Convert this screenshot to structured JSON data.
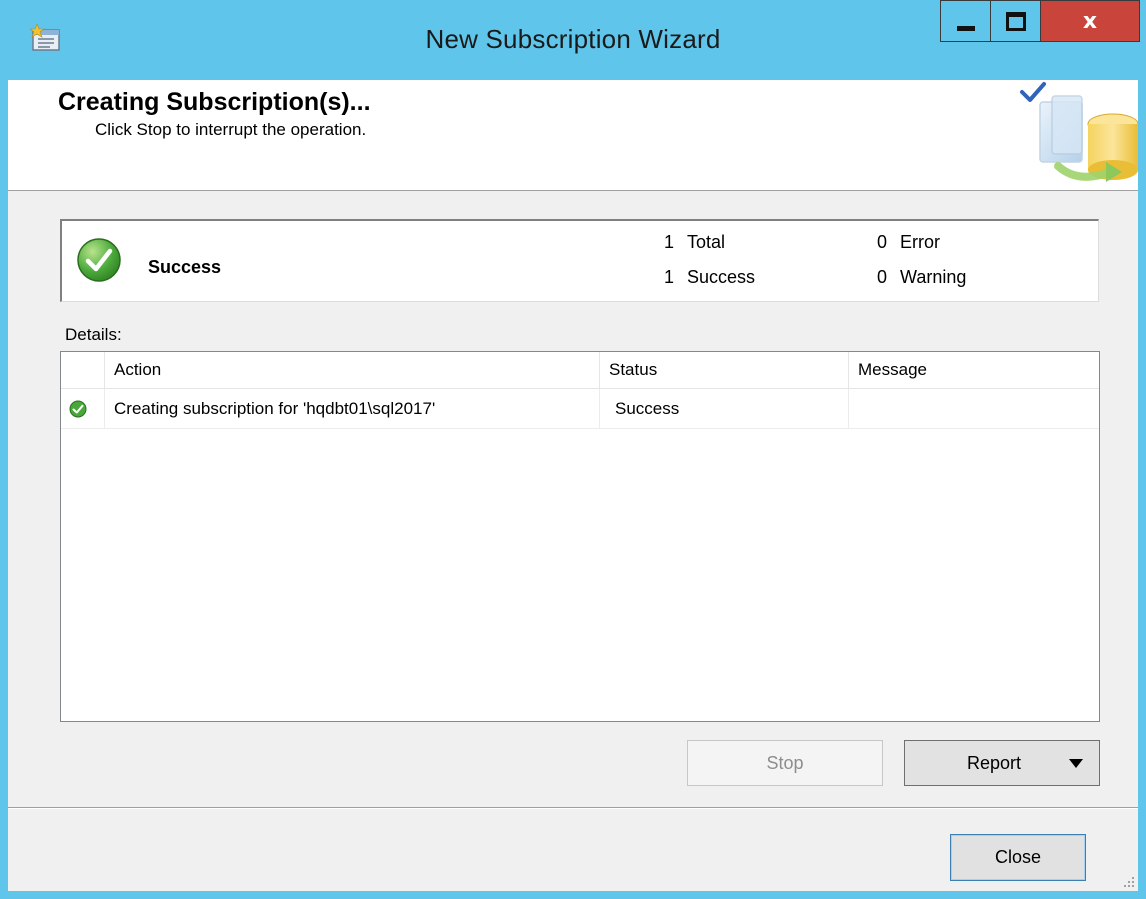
{
  "window": {
    "title": "New Subscription Wizard",
    "app_icon": "wizard-app-icon",
    "controls": {
      "minimize": "minimize-icon",
      "maximize": "maximize-icon",
      "close_glyph": "x"
    }
  },
  "header": {
    "title": "Creating Subscription(s)...",
    "subtitle": "Click Stop to interrupt the operation.",
    "graphic": "database-checkmark-graphic"
  },
  "summary": {
    "status": "Success",
    "status_icon": "success-check-icon",
    "stats": [
      {
        "count": "1",
        "label": "Total"
      },
      {
        "count": "1",
        "label": "Success"
      },
      {
        "count": "0",
        "label": "Error"
      },
      {
        "count": "0",
        "label": "Warning"
      }
    ]
  },
  "details": {
    "label": "Details:",
    "columns": [
      "Action",
      "Status",
      "Message"
    ],
    "rows": [
      {
        "icon": "success-check-icon",
        "action": "Creating subscription for 'hqdbt01\\sql2017'",
        "status": "Success",
        "message": ""
      }
    ]
  },
  "buttons": {
    "stop": "Stop",
    "report": "Report",
    "close": "Close"
  },
  "colors": {
    "titlebar": "#5fc5ea",
    "close_button": "#c9443b",
    "client_bg": "#f0f0f0",
    "success_green": "#4aa83a"
  }
}
